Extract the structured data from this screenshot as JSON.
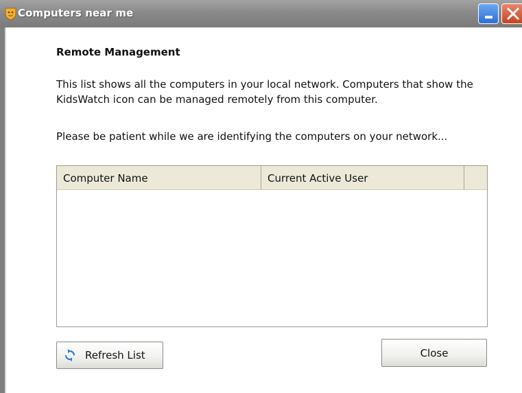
{
  "window": {
    "title": "Computers near me"
  },
  "content": {
    "heading": "Remote Management",
    "description": "This list shows all the computers in your local network. Computers that show the KidsWatch icon can be managed remotely from this computer.",
    "status_message": "Please be patient while we are identifying the computers on your network..."
  },
  "computer_list": {
    "columns": [
      "Computer Name",
      "Current Active User"
    ],
    "rows": []
  },
  "buttons": {
    "refresh_label": "Refresh List",
    "close_label": "Close"
  },
  "colors": {
    "titlebar": "#8a8a8a",
    "minimize_button": "#2e6fd6",
    "close_window_button": "#c8431f",
    "list_header": "#ece9d8",
    "refresh_icon": "#2a7fd4"
  }
}
